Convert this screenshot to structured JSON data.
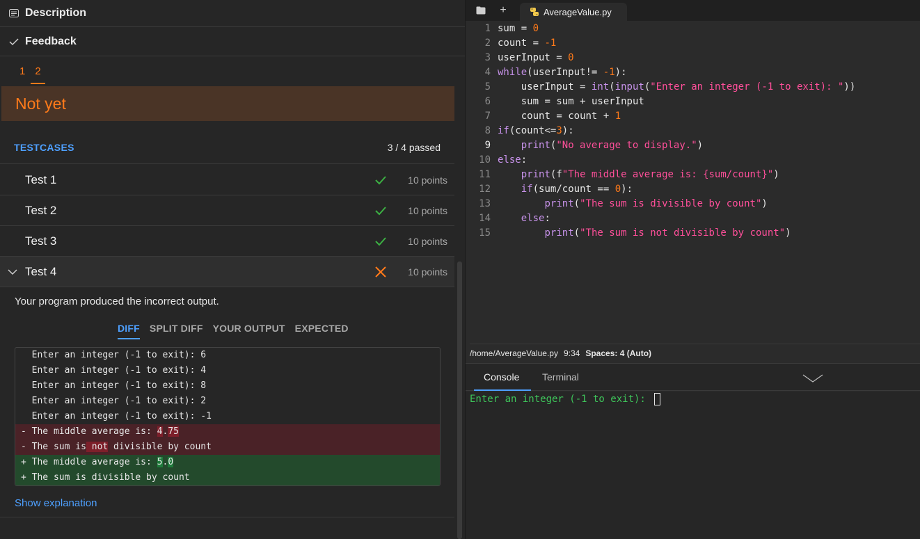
{
  "left": {
    "description_label": "Description",
    "feedback_label": "Feedback",
    "attempts": [
      "1",
      "2"
    ],
    "status": "Not yet",
    "testcases_title": "TESTCASES",
    "testcases_summary": "3 / 4 passed",
    "tests": [
      {
        "name": "Test 1",
        "points": "10 points",
        "status": "pass"
      },
      {
        "name": "Test 2",
        "points": "10 points",
        "status": "pass"
      },
      {
        "name": "Test 3",
        "points": "10 points",
        "status": "pass"
      },
      {
        "name": "Test 4",
        "points": "10 points",
        "status": "fail"
      }
    ],
    "incorrect_msg": "Your program produced the incorrect output.",
    "diff_tabs": [
      "DIFF",
      "SPLIT DIFF",
      "YOUR OUTPUT",
      "EXPECTED"
    ],
    "diff_lines": [
      "  Enter an integer (-1 to exit): 6",
      "  Enter an integer (-1 to exit): 4",
      "  Enter an integer (-1 to exit): 8",
      "  Enter an integer (-1 to exit): 2",
      "  Enter an integer (-1 to exit): -1",
      "- The middle average is: 4.75",
      "- The sum is not divisible by count",
      "+ The middle average is: 5.0",
      "+ The sum is divisible by count"
    ],
    "show_explanation": "Show explanation"
  },
  "editor": {
    "file_tab": "AverageValue.py",
    "line_numbers": [
      "1",
      "2",
      "3",
      "4",
      "5",
      "6",
      "7",
      "8",
      "9",
      "10",
      "11",
      "12",
      "13",
      "14",
      "15"
    ],
    "code_lines": [
      "sum = 0",
      "count = -1",
      "userInput = 0",
      "while(userInput!= -1):",
      "    userInput = int(input(\"Enter an integer (-1 to exit): \"))",
      "    sum = sum + userInput",
      "    count = count + 1",
      "if(count<=3):",
      "    print(\"No average to display.\")",
      "else:",
      "    print(f\"The middle average is: {sum/count}\")",
      "    if(sum/count == 0):",
      "        print(\"The sum is divisible by count\")",
      "    else:",
      "        print(\"The sum is not divisible by count\")"
    ],
    "status_path": "/home/AverageValue.py",
    "status_pos": "9:34",
    "status_spaces": "Spaces: 4 (Auto)"
  },
  "console": {
    "tabs": [
      "Console",
      "Terminal"
    ],
    "prompt": "Enter an integer (-1 to exit): "
  },
  "colors": {
    "accent_blue": "#4ea0ff",
    "accent_orange": "#ff7a1a",
    "pass_green": "#3cb043",
    "fail_orange": "#ff7a1a"
  },
  "icons": {
    "description": "description-icon",
    "feedback": "check-icon",
    "pass": "check-icon",
    "fail": "x-icon",
    "collapse": "chevron-down-icon"
  }
}
